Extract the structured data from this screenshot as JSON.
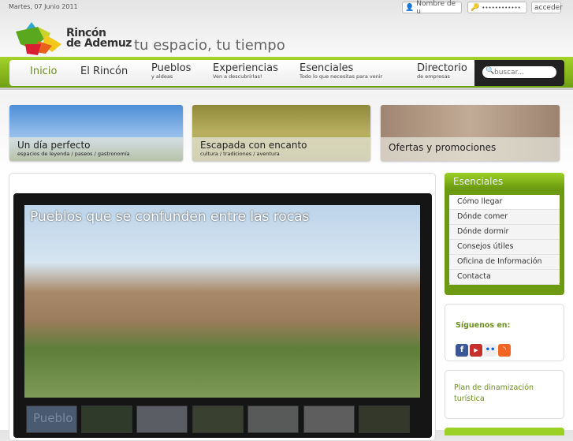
{
  "header": {
    "date": "Martes, 07 Junio 2011",
    "username_placeholder": "Nombre de u",
    "password_value": "••••••••••••",
    "login_button": "acceder",
    "brand_line1": "Rincón",
    "brand_line2": "de Ademuz",
    "tagline": "tu espacio, tu tiempo"
  },
  "nav": {
    "items": [
      {
        "label": "Inicio",
        "sub": ""
      },
      {
        "label": "El Rincón",
        "sub": ""
      },
      {
        "label": "Pueblos",
        "sub": "y aldeas"
      },
      {
        "label": "Experiencias",
        "sub": "Ven a descubrirlas!"
      },
      {
        "label": "Esenciales",
        "sub": "Todo lo que necesitas para venir"
      },
      {
        "label": "Directorio",
        "sub": "de empresas"
      }
    ],
    "search_placeholder": "buscar...",
    "active_color": "#6b8f1a"
  },
  "promos": [
    {
      "title": "Un día perfecto",
      "sub": "espacios de leyenda / paseos / gastronomía"
    },
    {
      "title": "Escapada con encanto",
      "sub": "cultura / tradiciones / aventura"
    },
    {
      "title": "Ofertas y promociones",
      "sub": ""
    }
  ],
  "slideshow": {
    "title": "Pueblos que se confunden entre las rocas",
    "thumb_caption": "Pueblo"
  },
  "sidebar": {
    "esenciales_title": "Esenciales",
    "esenciales_items": [
      "Cómo llegar",
      "Dónde comer",
      "Dónde dormir",
      "Consejos útiles",
      "Oficina de Información",
      "Contacta"
    ],
    "follow_title": "Síguenos en:",
    "social": [
      "facebook-icon",
      "youtube-icon",
      "flickr-icon",
      "rss-icon"
    ],
    "plan_link": "Plan de dinamización turística"
  }
}
